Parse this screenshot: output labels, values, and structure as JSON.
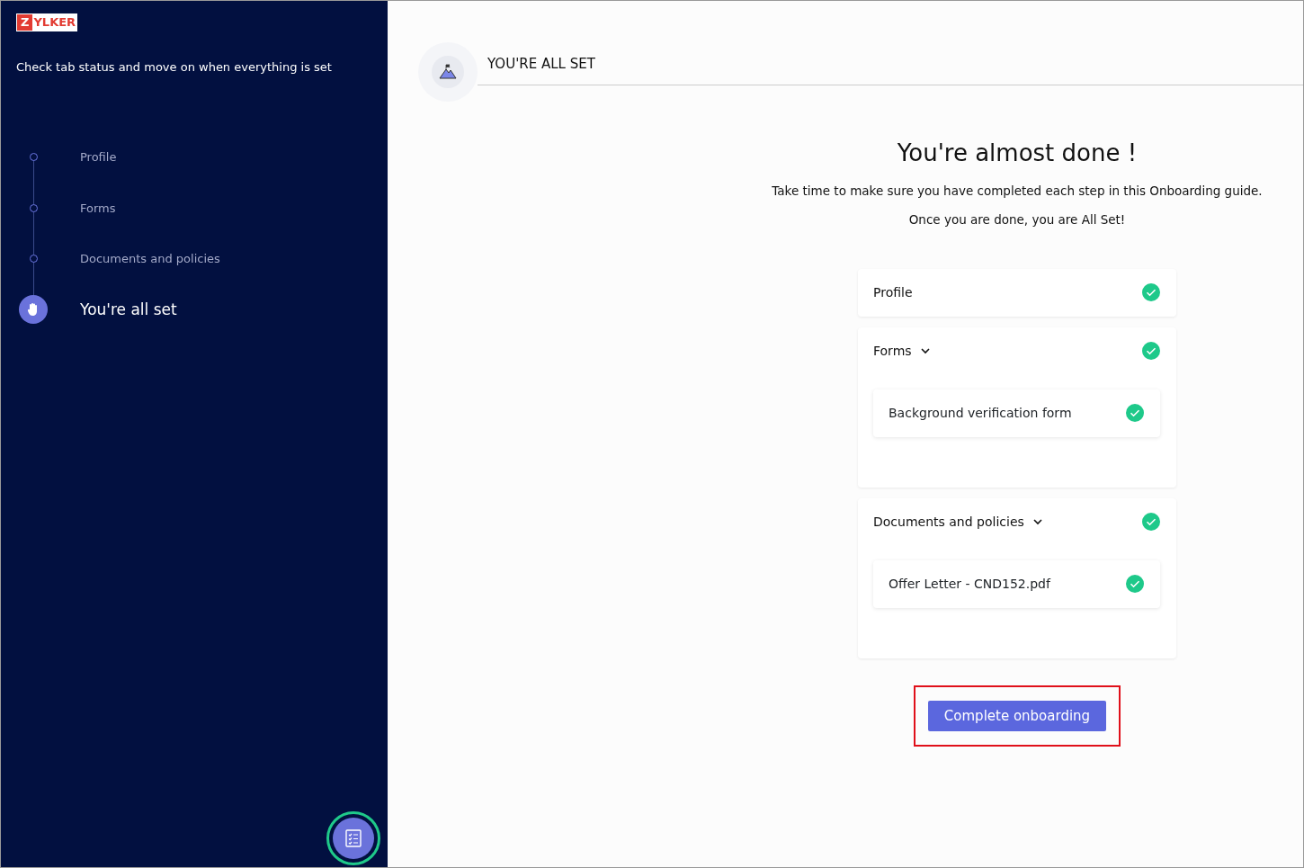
{
  "logo": {
    "initial": "Z",
    "rest": "YLKER"
  },
  "sidebar": {
    "subtitle": "Check tab status and move on when everything is set",
    "steps": [
      {
        "label": "Profile",
        "selected": false
      },
      {
        "label": "Forms",
        "selected": false
      },
      {
        "label": "Documents and policies",
        "selected": false
      },
      {
        "label": "You're all set",
        "selected": true
      }
    ]
  },
  "header": {
    "title": "YOU'RE ALL SET"
  },
  "main": {
    "heading": "You're almost done !",
    "lines": [
      "Take time to make sure you have completed each step in this Onboarding guide.",
      "Once you are done, you are All Set!"
    ],
    "sections": [
      {
        "title": "Profile",
        "completed": true,
        "expandable": false
      },
      {
        "title": "Forms",
        "completed": true,
        "expandable": true,
        "expanded": true,
        "children": [
          {
            "title": "Background verification form",
            "completed": true
          }
        ]
      },
      {
        "title": "Documents and policies",
        "completed": true,
        "expandable": true,
        "expanded": true,
        "children": [
          {
            "title": "Offer Letter - CND152.pdf",
            "completed": true
          }
        ]
      }
    ],
    "button": "Complete onboarding"
  }
}
